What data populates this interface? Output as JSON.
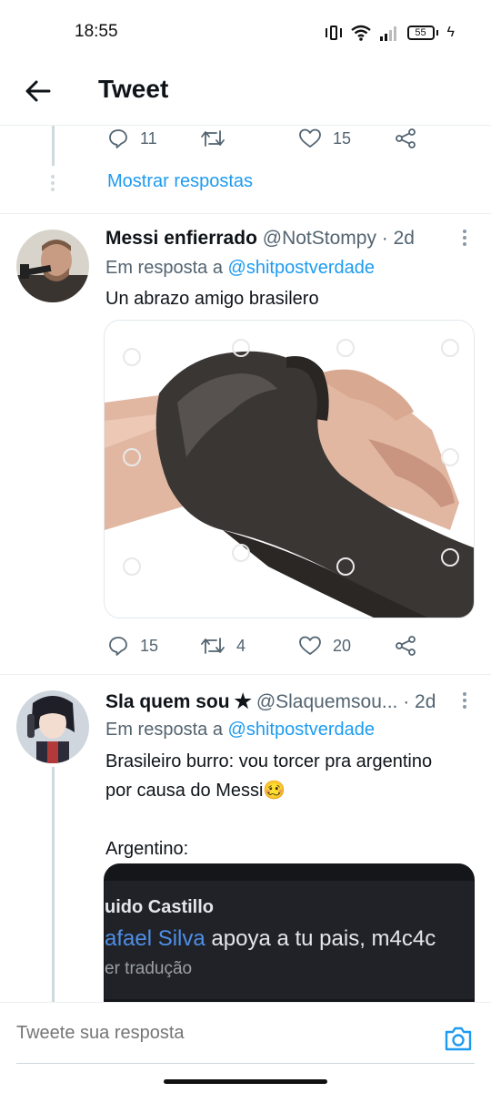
{
  "status_bar": {
    "time": "18:55",
    "battery": "55"
  },
  "header": {
    "title": "Tweet"
  },
  "previous_tweet": {
    "reply_count": "11",
    "retweet_count": "",
    "like_count": "15",
    "show_replies": "Mostrar respostas"
  },
  "tweets": [
    {
      "name": "Messi enfierrado",
      "handle": "@NotStompy",
      "time": "· 2d",
      "reply_prefix": "Em resposta a ",
      "reply_to": "@shitpostverdade",
      "text": "Un abrazo amigo brasilero",
      "reply_count": "15",
      "retweet_count": "4",
      "like_count": "20"
    },
    {
      "name": "Sla quem sou ✭",
      "handle": "@Slaquemsou...",
      "time": "· 2d",
      "reply_prefix": "Em resposta a ",
      "reply_to": "@shitpostverdade",
      "text_line1": "Brasileiro burro: vou torcer pra argentino",
      "text_line2": "por causa do Messi",
      "emoji": "🥴",
      "text_line3": "Argentino:",
      "screenshot": {
        "name": "uido Castillo",
        "mention": "afael Silva",
        "comment": " apoya a tu pais, m4c4c",
        "translate": "er tradução"
      }
    }
  ],
  "reply_bar": {
    "placeholder": "Tweete sua resposta"
  },
  "colors": {
    "accent": "#1d9bf0",
    "muted": "#536471",
    "text": "#0f1419"
  }
}
